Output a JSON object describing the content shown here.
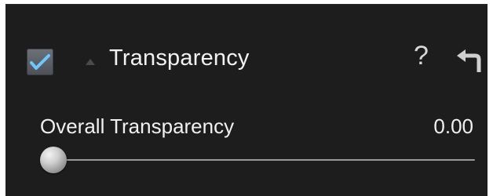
{
  "panel": {
    "enabled": true,
    "title": "Transparency",
    "help_label": "?",
    "accent_color": "#6ec6ff",
    "icons": {
      "checkbox": "checkmark-icon",
      "disclosure": "triangle-up-icon",
      "reset": "reset-arrow-icon"
    }
  },
  "parameter": {
    "label": "Overall Transparency",
    "value": "0.00",
    "slider_fraction": 0.0
  }
}
